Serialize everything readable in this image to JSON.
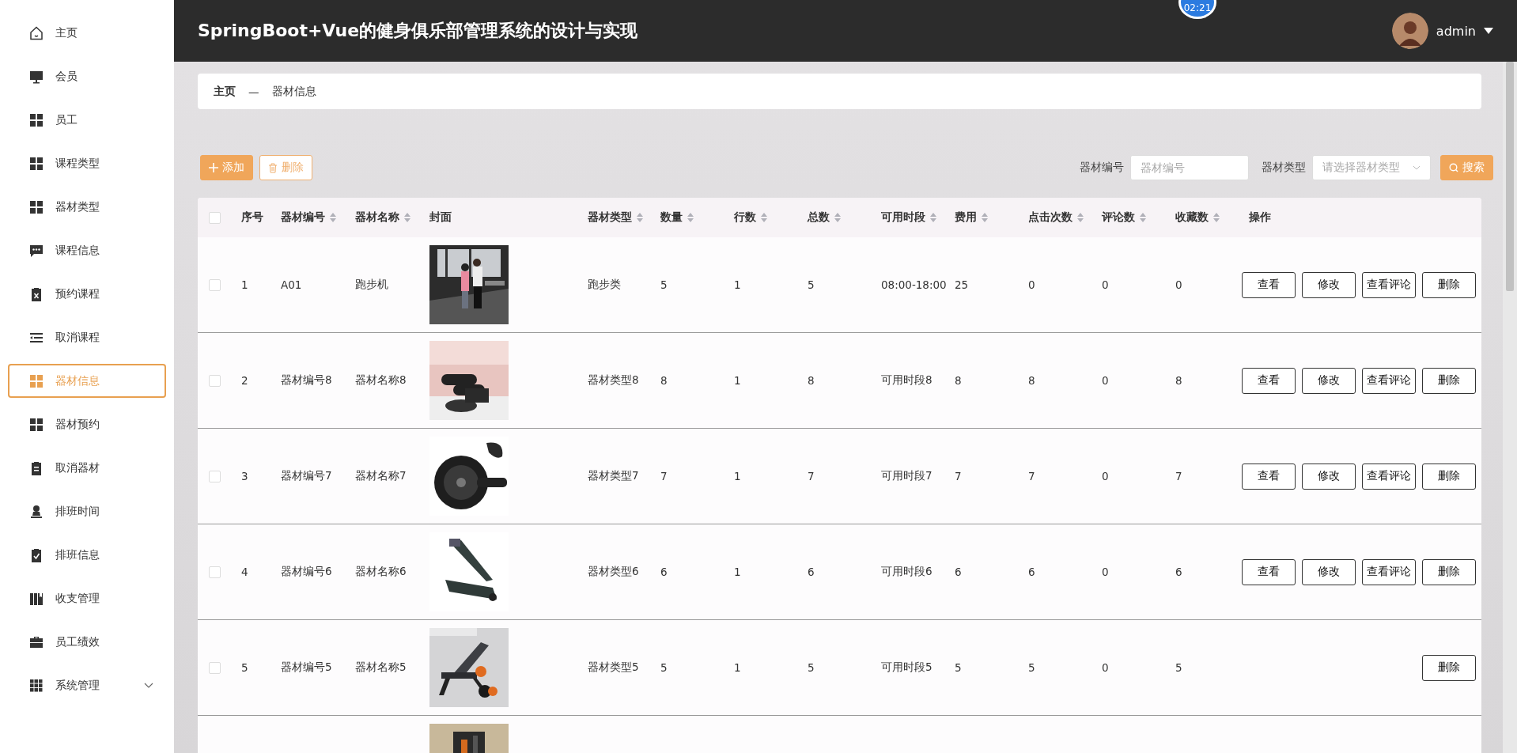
{
  "sidebar": {
    "items": [
      {
        "label": "主页",
        "selected": false,
        "expandable": false
      },
      {
        "label": "会员",
        "selected": false,
        "expandable": false
      },
      {
        "label": "员工",
        "selected": false,
        "expandable": false
      },
      {
        "label": "课程类型",
        "selected": false,
        "expandable": false
      },
      {
        "label": "器材类型",
        "selected": false,
        "expandable": false
      },
      {
        "label": "课程信息",
        "selected": false,
        "expandable": false
      },
      {
        "label": "预约课程",
        "selected": false,
        "expandable": false
      },
      {
        "label": "取消课程",
        "selected": false,
        "expandable": false
      },
      {
        "label": "器材信息",
        "selected": true,
        "expandable": false
      },
      {
        "label": "器材预约",
        "selected": false,
        "expandable": false
      },
      {
        "label": "取消器材",
        "selected": false,
        "expandable": false
      },
      {
        "label": "排班时间",
        "selected": false,
        "expandable": false
      },
      {
        "label": "排班信息",
        "selected": false,
        "expandable": false
      },
      {
        "label": "收支管理",
        "selected": false,
        "expandable": false
      },
      {
        "label": "员工绩效",
        "selected": false,
        "expandable": false
      },
      {
        "label": "系统管理",
        "selected": false,
        "expandable": true
      }
    ]
  },
  "header": {
    "title": "SpringBoot+Vue的健身俱乐部管理系统的设计与实现",
    "timer": "02:21",
    "user": "admin"
  },
  "breadcrumb": [
    "主页",
    "—",
    "器材信息"
  ],
  "toolbar": {
    "add": "添加",
    "delete": "删除",
    "filters": [
      {
        "label": "器材编号",
        "kind": "input",
        "placeholder": "器材编号"
      },
      {
        "label": "器材类型",
        "kind": "select",
        "placeholder": "请选择器材类型"
      }
    ],
    "search": "搜索"
  },
  "table": {
    "all_checked": false,
    "columns": [
      {
        "label": "序号",
        "sortable": false
      },
      {
        "label": "器材编号",
        "sortable": true
      },
      {
        "label": "器材名称",
        "sortable": true
      },
      {
        "label": "封面",
        "sortable": false
      },
      {
        "label": "器材类型",
        "sortable": true
      },
      {
        "label": "数量",
        "sortable": true
      },
      {
        "label": "行数",
        "sortable": true
      },
      {
        "label": "总数",
        "sortable": true
      },
      {
        "label": "可用时段",
        "sortable": true
      },
      {
        "label": "费用",
        "sortable": true
      },
      {
        "label": "点击次数",
        "sortable": true
      },
      {
        "label": "评论数",
        "sortable": true
      },
      {
        "label": "收藏数",
        "sortable": true
      },
      {
        "label": "操作",
        "sortable": false
      }
    ],
    "rows": [
      {
        "checked": false,
        "cells": [
          "1",
          "A01",
          "跑步机",
          {
            "kind": "picture"
          },
          "跑步类",
          "5",
          "1",
          "5",
          "08:00-18:00",
          "25",
          "0",
          "0",
          "0"
        ],
        "actions": [
          "查看",
          "修改",
          "查看评论",
          "删除"
        ]
      },
      {
        "checked": false,
        "cells": [
          "2",
          "器材编号8",
          "器材名称8",
          {
            "kind": "picture"
          },
          "器材类型8",
          "8",
          "1",
          "8",
          "可用时段8",
          "8",
          "8",
          "0",
          "8"
        ],
        "actions": [
          "查看",
          "修改",
          "查看评论",
          "删除"
        ]
      },
      {
        "checked": false,
        "cells": [
          "3",
          "器材编号7",
          "器材名称7",
          {
            "kind": "picture"
          },
          "器材类型7",
          "7",
          "1",
          "7",
          "可用时段7",
          "7",
          "7",
          "0",
          "7"
        ],
        "actions": [
          "查看",
          "修改",
          "查看评论",
          "删除"
        ]
      },
      {
        "checked": false,
        "cells": [
          "4",
          "器材编号6",
          "器材名称6",
          {
            "kind": "picture"
          },
          "器材类型6",
          "6",
          "1",
          "6",
          "可用时段6",
          "6",
          "6",
          "0",
          "6"
        ],
        "actions": [
          "查看",
          "修改",
          "查看评论",
          "删除"
        ]
      },
      {
        "checked": false,
        "cells": [
          "5",
          "器材编号5",
          "器材名称5",
          {
            "kind": "picture"
          },
          "器材类型5",
          "5",
          "1",
          "5",
          "可用时段5",
          "5",
          "5",
          "0",
          "5"
        ],
        "actions": [
          "删除"
        ]
      },
      {
        "cells": [
          "",
          "",
          "",
          {
            "kind": "picture"
          }
        ],
        "actions": []
      }
    ]
  }
}
